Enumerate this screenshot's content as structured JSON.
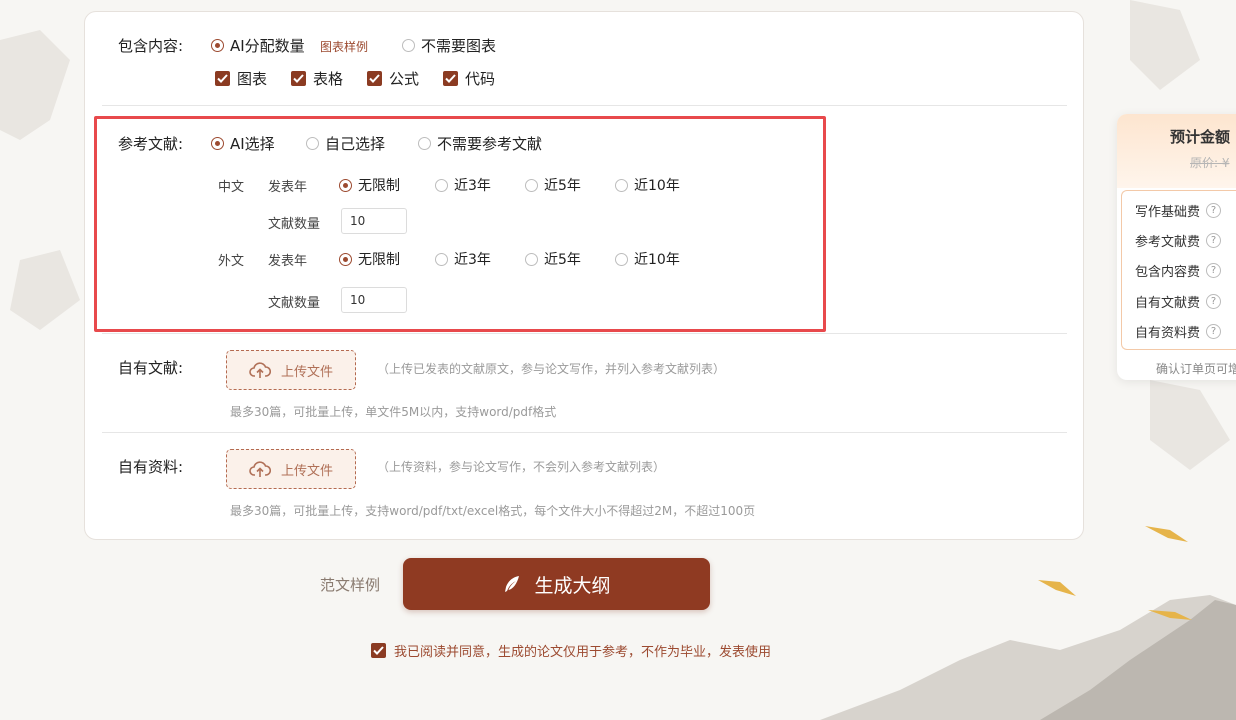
{
  "include_content": {
    "label": "包含内容:",
    "options": [
      {
        "label": "AI分配数量",
        "selected": true
      },
      {
        "label": "不需要图表",
        "selected": false
      }
    ],
    "sample_link": "图表样例",
    "checkboxes": [
      {
        "label": "图表",
        "checked": true
      },
      {
        "label": "表格",
        "checked": true
      },
      {
        "label": "公式",
        "checked": true
      },
      {
        "label": "代码",
        "checked": true
      }
    ]
  },
  "references": {
    "label": "参考文献:",
    "options": [
      {
        "label": "AI选择",
        "selected": true
      },
      {
        "label": "自己选择",
        "selected": false
      },
      {
        "label": "不需要参考文献",
        "selected": false
      }
    ],
    "chinese": {
      "lang_label": "中文",
      "year_label": "发表年",
      "year_options": [
        {
          "label": "无限制",
          "selected": true
        },
        {
          "label": "近3年",
          "selected": false
        },
        {
          "label": "近5年",
          "selected": false
        },
        {
          "label": "近10年",
          "selected": false
        }
      ],
      "count_label": "文献数量",
      "count_value": "10"
    },
    "foreign": {
      "lang_label": "外文",
      "year_label": "发表年",
      "year_options": [
        {
          "label": "无限制",
          "selected": true
        },
        {
          "label": "近3年",
          "selected": false
        },
        {
          "label": "近5年",
          "selected": false
        },
        {
          "label": "近10年",
          "selected": false
        }
      ],
      "count_label": "文献数量",
      "count_value": "10"
    }
  },
  "own_literature": {
    "label": "自有文献:",
    "upload_label": "上传文件",
    "note": "（上传已发表的文献原文，参与论文写作，并列入参考文献列表）",
    "hint": "最多30篇，可批量上传，单文件5M以内，支持word/pdf格式"
  },
  "own_materials": {
    "label": "自有资料:",
    "upload_label": "上传文件",
    "note": "（上传资料，参与论文写作，不会列入参考文献列表）",
    "hint": "最多30篇，可批量上传，支持word/pdf/txt/excel格式，每个文件大小不得超过2M，不超过100页"
  },
  "actions": {
    "sample_link": "范文样例",
    "generate_label": "生成大纲"
  },
  "agreement": {
    "checked": true,
    "text": "我已阅读并同意，生成的论文仅用于参考，不作为毕业，发表使用"
  },
  "price_panel": {
    "title": "预计金额",
    "original_price": "原价: ¥",
    "fees": [
      "写作基础费",
      "参考文献费",
      "包含内容费",
      "自有文献费",
      "自有资料费"
    ],
    "footer": "确认订单页可增"
  },
  "colors": {
    "accent": "#8f3a22",
    "highlight": "#e8494c"
  }
}
